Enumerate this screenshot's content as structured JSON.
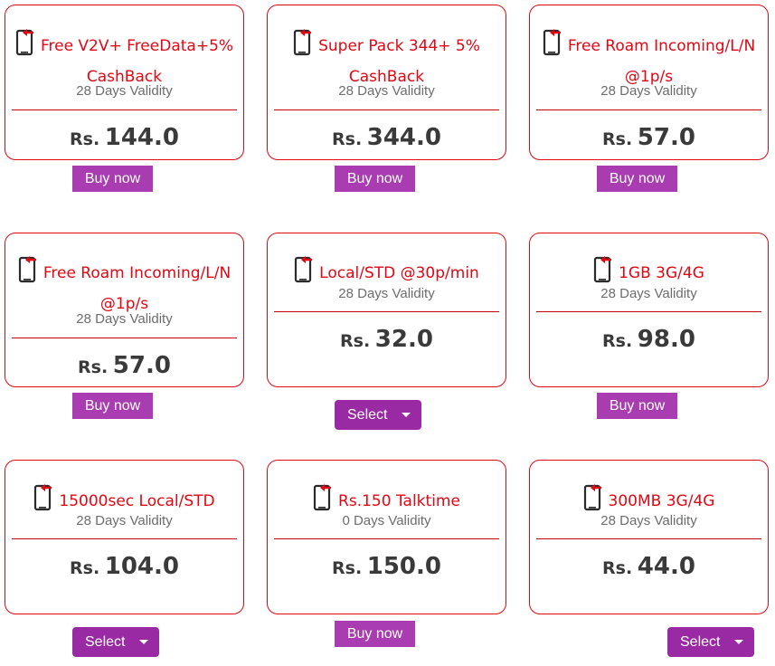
{
  "icon": "mobile-phone-arrow-icon",
  "accent_color": "#e30613",
  "button_color": "#a93cb1",
  "currency": "Rs.",
  "buy_label": "Buy now",
  "select_label": "Select",
  "plans": [
    {
      "title_line1": "Free V2V+ FreeData+5%",
      "title_line2": "CashBack",
      "validity": "28 Days Validity",
      "price": "144.0",
      "action": "buy"
    },
    {
      "title_line1": "Super Pack 344+ 5%",
      "title_line2": "CashBack",
      "validity": "28 Days Validity",
      "price": "344.0",
      "action": "buy"
    },
    {
      "title_line1": "Free Roam Incoming/L/N",
      "title_line2": "@1p/s",
      "validity": "28 Days Validity",
      "price": "57.0",
      "action": "buy"
    },
    {
      "title_line1": "Free Roam Incoming/L/N",
      "title_line2": "@1p/s",
      "validity": "28 Days Validity",
      "price": "57.0",
      "action": "buy"
    },
    {
      "title_line1": "Local/STD @30p/min",
      "title_line2": "",
      "validity": "28 Days Validity",
      "price": "32.0",
      "action": "select"
    },
    {
      "title_line1": "1GB 3G/4G",
      "title_line2": "",
      "validity": "28 Days Validity",
      "price": "98.0",
      "action": "buy"
    },
    {
      "title_line1": "15000sec Local/STD",
      "title_line2": "",
      "validity": "28 Days Validity",
      "price": "104.0",
      "action": "select"
    },
    {
      "title_line1": "Rs.150 Talktime",
      "title_line2": "",
      "validity": "0 Days Validity",
      "price": "150.0",
      "action": "buy"
    },
    {
      "title_line1": "300MB 3G/4G",
      "title_line2": "",
      "validity": "28 Days Validity",
      "price": "44.0",
      "action": "select"
    }
  ]
}
